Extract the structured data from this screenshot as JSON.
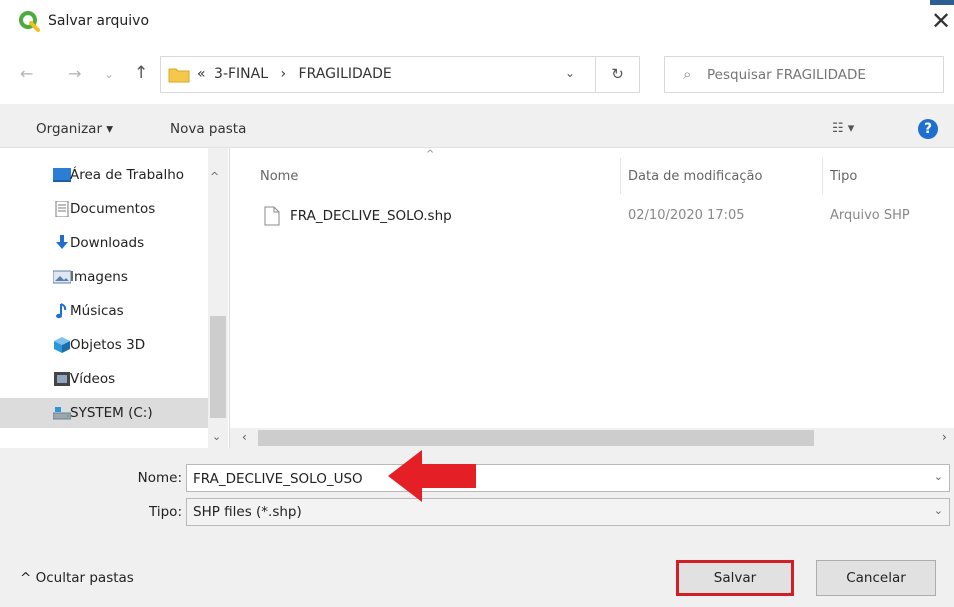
{
  "window": {
    "title": "Salvar arquivo",
    "close_glyph": "✕"
  },
  "nav": {
    "back_glyph": "←",
    "forward_glyph": "→",
    "recent_glyph": "⌄",
    "up_glyph": "↑",
    "breadcrumb": [
      "«",
      "3-FINAL",
      "›",
      "FRAGILIDADE"
    ],
    "address_dropdown_glyph": "⌄",
    "refresh_glyph": "↻",
    "search_glyph": "⌕",
    "search_placeholder": "Pesquisar FRAGILIDADE"
  },
  "toolbar": {
    "organize_label": "Organizar ▾",
    "new_folder_label": "Nova pasta",
    "view_glyph": "☷ ▾",
    "help_glyph": "?"
  },
  "sidebar": {
    "items": [
      {
        "label": "Área de Trabalho",
        "icon": "desktop-icon",
        "color": "#2a7fd4"
      },
      {
        "label": "Documentos",
        "icon": "document-icon",
        "color": "#7a7a7a"
      },
      {
        "label": "Downloads",
        "icon": "download-icon",
        "color": "#1f6fd1"
      },
      {
        "label": "Imagens",
        "icon": "image-icon",
        "color": "#5a7fa8"
      },
      {
        "label": "Músicas",
        "icon": "music-icon",
        "color": "#1f6fd1"
      },
      {
        "label": "Objetos 3D",
        "icon": "cube-icon",
        "color": "#2b96d8"
      },
      {
        "label": "Vídeos",
        "icon": "video-icon",
        "color": "#444444"
      },
      {
        "label": "SYSTEM (C:)",
        "icon": "drive-icon",
        "color": "#6f7f8f",
        "selected": true
      }
    ],
    "scroll_up_glyph": "^",
    "scroll_down_glyph": "⌄"
  },
  "filelist": {
    "columns": [
      "Nome",
      "Data de modificação",
      "Tipo"
    ],
    "sort_glyph": "^",
    "rows": [
      {
        "name": "FRA_DECLIVE_SOLO.shp",
        "date": "02/10/2020 17:05",
        "type": "Arquivo SHP"
      }
    ],
    "hscroll_left_glyph": "‹",
    "hscroll_right_glyph": "›"
  },
  "form": {
    "name_label": "Nome:",
    "name_value": "FRA_DECLIVE_SOLO_USO",
    "type_label": "Tipo:",
    "type_value": "SHP files (*.shp)",
    "dropdown_glyph": "⌄"
  },
  "footer": {
    "hide_folders_label": "^ Ocultar pastas",
    "save_label": "Salvar",
    "cancel_label": "Cancelar"
  },
  "colors": {
    "highlight": "#cf2027",
    "accent": "#1e6fd0",
    "app_icon": "#4bab3c"
  }
}
